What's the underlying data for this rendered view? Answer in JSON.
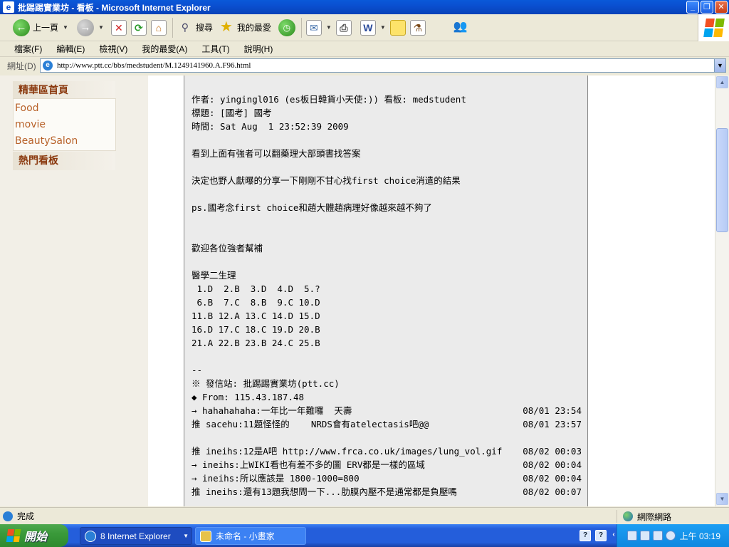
{
  "window": {
    "title": "批踢踢實業坊 - 看板 - Microsoft Internet Explorer"
  },
  "toolbar": {
    "back_label": "上一頁",
    "search_label": "搜尋",
    "favorites_label": "我的最愛"
  },
  "menu": [
    "檔案(F)",
    "編輯(E)",
    "檢視(V)",
    "我的最愛(A)",
    "工具(T)",
    "說明(H)"
  ],
  "address": {
    "label": "網址(D)",
    "url": "http://www.ptt.cc/bbs/medstudent/M.1249141960.A.F96.html"
  },
  "sidebar": {
    "heading1": "精華區首頁",
    "links": [
      "Food",
      "movie",
      "BeautySalon"
    ],
    "heading2": "熱門看板"
  },
  "article": {
    "lines": [
      "作者: yingingl016 (es板日韓貨小天使:)) 看板: medstudent",
      "標題: [國考] 國考",
      "時間: Sat Aug  1 23:52:39 2009",
      "",
      "看到上面有強者可以翻藥理大部頭書找答案",
      "",
      "決定也野人獻曝的分享一下剛剛不甘心找first choice消遣的結果",
      "",
      "ps.國考念first choice和趙大體趙病理好像越來越不夠了",
      "",
      "",
      "歡迎各位強者幫補",
      "",
      "醫學二生理",
      " 1.D  2.B  3.D  4.D  5.?",
      " 6.B  7.C  8.B  9.C 10.D",
      "11.B 12.A 13.C 14.D 15.D",
      "16.D 17.C 18.C 19.D 20.B",
      "21.A 22.B 23.B 24.C 25.B",
      "",
      "--",
      "※ 發信站: 批踢踢實業坊(ptt.cc)",
      "◆ From: 115.43.187.48"
    ],
    "comments": [
      {
        "text": "→ hahahahaha:一年比一年難囉  天壽",
        "time": "08/01 23:54"
      },
      {
        "text": "推 sacehu:11題怪怪的    NRDS會有atelectasis吧@@",
        "time": "08/01 23:57"
      },
      {
        "text": "",
        "time": ""
      },
      {
        "text": "推 ineihs:12是A吧 http://www.frca.co.uk/images/lung_vol.gif",
        "time": "08/02 00:03"
      },
      {
        "text": "→ ineihs:上WIKI看也有差不多的圖 ERV都是一樣的區域",
        "time": "08/02 00:04"
      },
      {
        "text": "→ ineihs:所以應該是 1800-1000=800",
        "time": "08/02 00:04"
      },
      {
        "text": "推 ineihs:還有13題我想問一下...肋膜內壓不是通常都是負壓嗎",
        "time": "08/02 00:07"
      }
    ]
  },
  "status": {
    "text": "完成",
    "zone": "網際網路"
  },
  "taskbar": {
    "start": "開始",
    "tasks": [
      "8 Internet Explorer",
      "未命名 - 小畫家"
    ],
    "clock": "上午 03:19"
  }
}
